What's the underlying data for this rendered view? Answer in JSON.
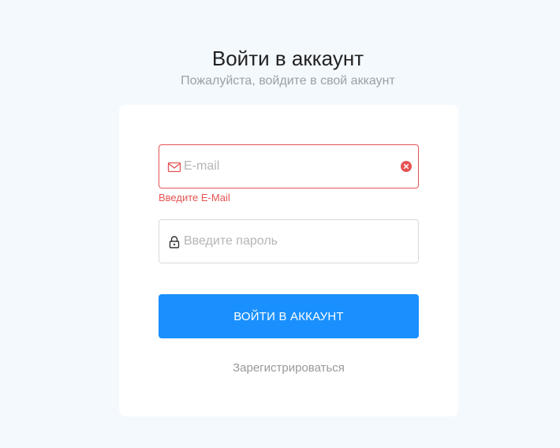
{
  "header": {
    "title": "Войти в аккаунт",
    "subtitle": "Пожалуйста, войдите в свой аккаунт"
  },
  "form": {
    "email": {
      "value": "",
      "placeholder": "E-mail",
      "icon": "mail-icon",
      "error": "Введите E-Mail",
      "clear_icon": "clear-icon"
    },
    "password": {
      "value": "",
      "placeholder": "Введите пароль",
      "icon": "lock-icon"
    },
    "submit_label": "ВОЙТИ В АККАУНТ",
    "register_label": "Зарегистрироваться"
  },
  "colors": {
    "page_background": "#f4f9fe",
    "card_background": "#ffffff",
    "accent": "#1a90ff",
    "error": "#e55353"
  }
}
